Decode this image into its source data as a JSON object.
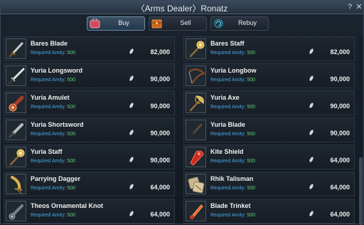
{
  "window": {
    "title": "〈Arms Dealer〉Ronatz",
    "help_glyph": "?",
    "close_glyph": "✕"
  },
  "tabs": [
    {
      "label": "Buy",
      "icon": "buy-bag-icon",
      "active": true,
      "color": "#d24a5c"
    },
    {
      "label": "Sell",
      "icon": "sell-chest-icon",
      "active": false,
      "color": "#c8641e"
    },
    {
      "label": "Rebuy",
      "icon": "rebuy-cycle-icon",
      "active": false,
      "color": "#2a8aa8"
    }
  ],
  "req_label": "Required Amity:",
  "items": [
    {
      "name": "Bares Blade",
      "amity": "500",
      "price": "82,000",
      "icon": "dagger-icon"
    },
    {
      "name": "Bares Staff",
      "amity": "500",
      "price": "82,000",
      "icon": "staff-icon"
    },
    {
      "name": "Yuria Longsword",
      "amity": "500",
      "price": "90,000",
      "icon": "longsword-icon"
    },
    {
      "name": "Yuria Longbow",
      "amity": "500",
      "price": "90,000",
      "icon": "longbow-icon"
    },
    {
      "name": "Yuria Amulet",
      "amity": "500",
      "price": "90,000",
      "icon": "amulet-icon"
    },
    {
      "name": "Yuria Axe",
      "amity": "500",
      "price": "90,000",
      "icon": "axe-icon"
    },
    {
      "name": "Yuria Shortsword",
      "amity": "500",
      "price": "90,000",
      "icon": "shortsword-icon"
    },
    {
      "name": "Yuria Blade",
      "amity": "500",
      "price": "90,000",
      "icon": "blade-icon"
    },
    {
      "name": "Yuria Staff",
      "amity": "500",
      "price": "90,000",
      "icon": "staff-icon"
    },
    {
      "name": "Kite Shield",
      "amity": "500",
      "price": "64,000",
      "icon": "kite-shield-icon"
    },
    {
      "name": "Parrying Dagger",
      "amity": "500",
      "price": "64,000",
      "icon": "parrying-dagger-icon"
    },
    {
      "name": "Rhik Talisman",
      "amity": "500",
      "price": "64,000",
      "icon": "talisman-icon"
    },
    {
      "name": "Theos Ornamental Knot",
      "amity": "500",
      "price": "64,000",
      "icon": "ornamental-knot-icon"
    },
    {
      "name": "Blade Trinket",
      "amity": "500",
      "price": "64,000",
      "icon": "trinket-icon"
    }
  ]
}
